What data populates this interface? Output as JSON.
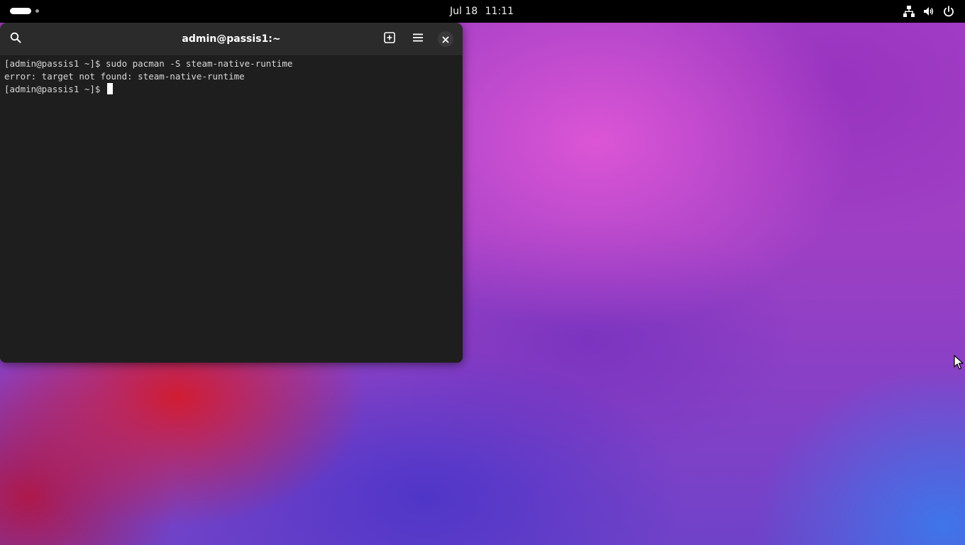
{
  "topbar": {
    "clock_date": "Jul 18",
    "clock_time": "11:11",
    "tray_icons": [
      "network-wired-icon",
      "volume-icon",
      "power-icon"
    ]
  },
  "terminal": {
    "title": "admin@passis1:~",
    "header_icons": [
      "search-icon",
      "new-tab-icon",
      "hamburger-menu-icon",
      "close-icon"
    ],
    "lines": [
      "[admin@passis1 ~]$ sudo pacman -S steam-native-runtime",
      "error: target not found: steam-native-runtime",
      "[admin@passis1 ~]$ "
    ]
  },
  "colors": {
    "topbar_bg": "#000000",
    "terminal_bg": "#1e1e1e",
    "headerbar_bg": "#2b2b2b",
    "terminal_text": "#d8d8d8"
  }
}
